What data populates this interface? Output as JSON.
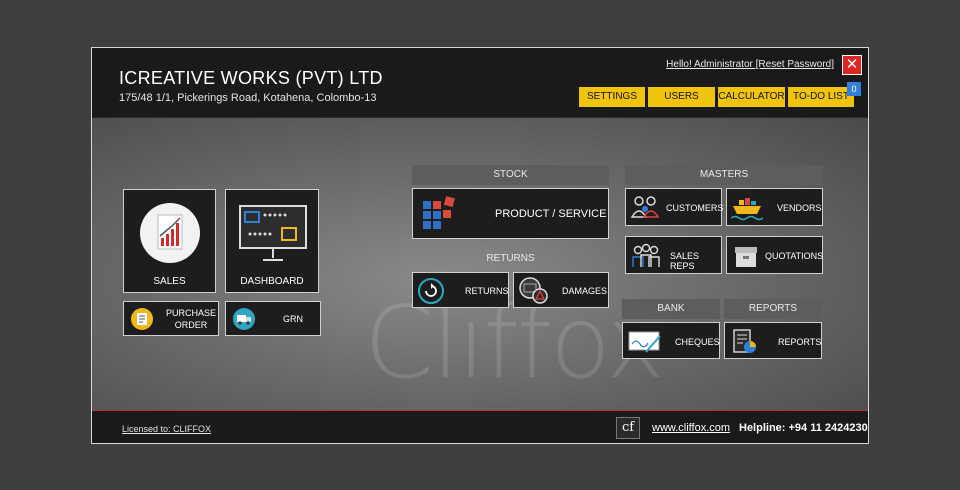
{
  "header": {
    "company_name": "ICREATIVE WORKS (PVT) LTD",
    "address": "175/48 1/1, Pickerings Road, Kotahena, Colombo-13",
    "greeting": "Hello! Administrator [Reset Password]",
    "close_glyph": "✕",
    "toolbar": {
      "settings": "SETTINGS",
      "users": "USERS",
      "calculator": "CALCULATOR",
      "todo": "TO-DO LIST",
      "todo_count": "0"
    }
  },
  "tiles": {
    "sales": "SALES",
    "dashboard": "DASHBOARD",
    "purchase_order_line1": "PURCHASE",
    "purchase_order_line2": "ORDER",
    "grn": "GRN"
  },
  "stock": {
    "header": "STOCK",
    "product_service": "PRODUCT / SERVICE"
  },
  "returns": {
    "header": "RETURNS",
    "returns": "RETURNS",
    "damages": "DAMAGES"
  },
  "masters": {
    "header": "MASTERS",
    "customers": "CUSTOMERS",
    "vendors": "VENDORS",
    "sales_reps": "SALES REPS",
    "quotations": "QUOTATIONS"
  },
  "bank": {
    "header": "BANK",
    "cheques": "CHEQUES"
  },
  "reports": {
    "header": "REPORTS",
    "reports": "REPORTS"
  },
  "footer": {
    "licensed": "Licensed to: CLIFFOX",
    "logo_text": "cf",
    "website": "www.cliffox.com",
    "helpline": "Helpline: +94 11 2424230"
  },
  "watermark": "Cliffox",
  "colors": {
    "accent_yellow": "#f0c40c",
    "close_red": "#e02525",
    "badge_blue": "#2f80d8",
    "tile_dark": "#1d1d1d"
  }
}
